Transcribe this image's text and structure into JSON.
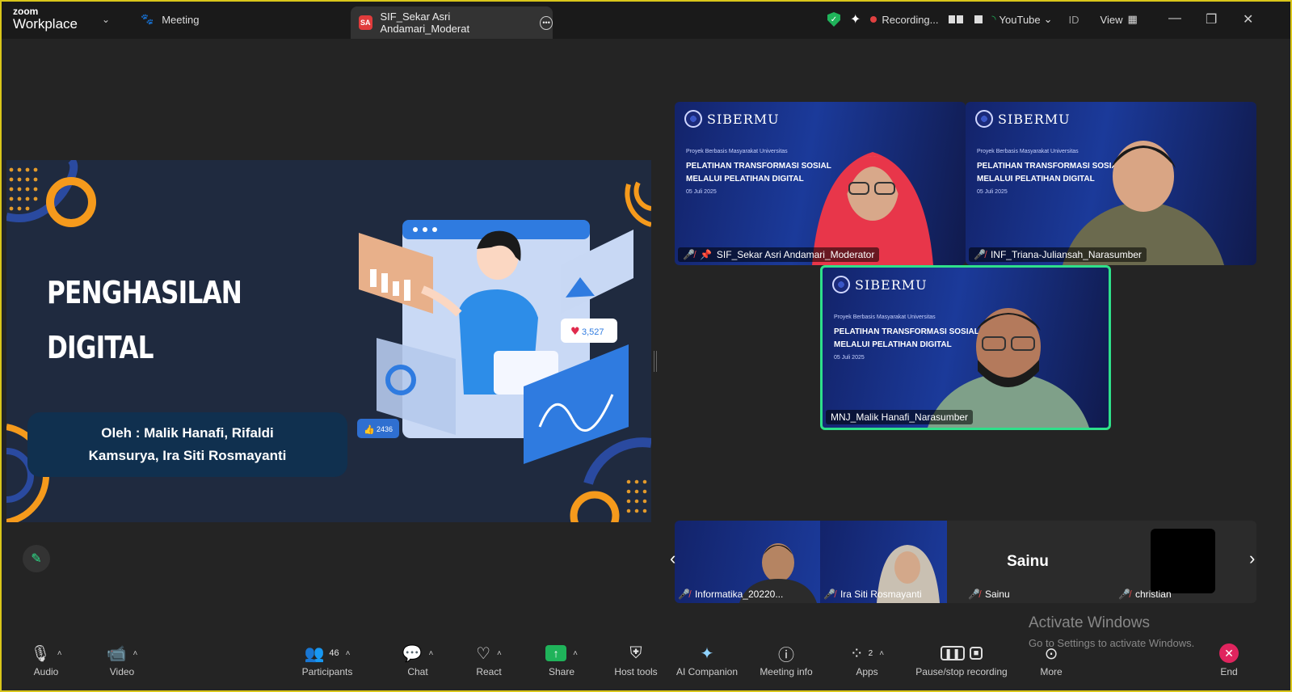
{
  "titlebar": {
    "brand_top": "zoom",
    "brand_bottom": "Workplace",
    "meeting_tab": "Meeting",
    "active_tab_badge": "SA",
    "active_tab_label": "SIF_Sekar Asri Andamari_Moderat",
    "recording": "Recording...",
    "stream_label": "YouTube",
    "id_label": "ID",
    "view_label": "View"
  },
  "slide": {
    "title_line1": "PENGHASILAN",
    "title_line2": "DIGITAL",
    "author_line1": "Oleh : Malik Hanafi, Rifaldi",
    "author_line2": "Kamsurya, Ira Siti Rosmayanti",
    "like_count": "3,527",
    "thumb_count": "2436"
  },
  "tiles": {
    "brand": "SIBERMU",
    "project": "Proyek Berbasis Masyarakat Universitas",
    "heading_line1": "PELATIHAN TRANSFORMASI SOSIAL",
    "heading_line2": "MELALUI PELATIHAN DIGITAL",
    "date": "05 Juli 2025",
    "tile1_name": "SIF_Sekar Asri Andamari_Moderator",
    "tile2_name": "INF_Triana-Juliansah_Narasumber",
    "tile3_name": "MNJ_Malik Hanafi_Narasumber"
  },
  "strip": {
    "mini1_name": "Informatika_20220...",
    "mini2_name": "Ira Siti Rosmayanti",
    "mini3_center": "Sainu",
    "mini3_name": "Sainu",
    "mini4_name": "christian"
  },
  "toolbar": {
    "audio": "Audio",
    "video": "Video",
    "participants": "Participants",
    "participants_count": "46",
    "chat": "Chat",
    "react": "React",
    "share": "Share",
    "host_tools": "Host tools",
    "ai_companion": "AI Companion",
    "meeting_info": "Meeting info",
    "apps": "Apps",
    "apps_count": "2",
    "pause_stop": "Pause/stop recording",
    "more": "More",
    "end": "End"
  },
  "watermark": {
    "line1": "Activate Windows",
    "line2": "Go to Settings to activate Windows."
  }
}
